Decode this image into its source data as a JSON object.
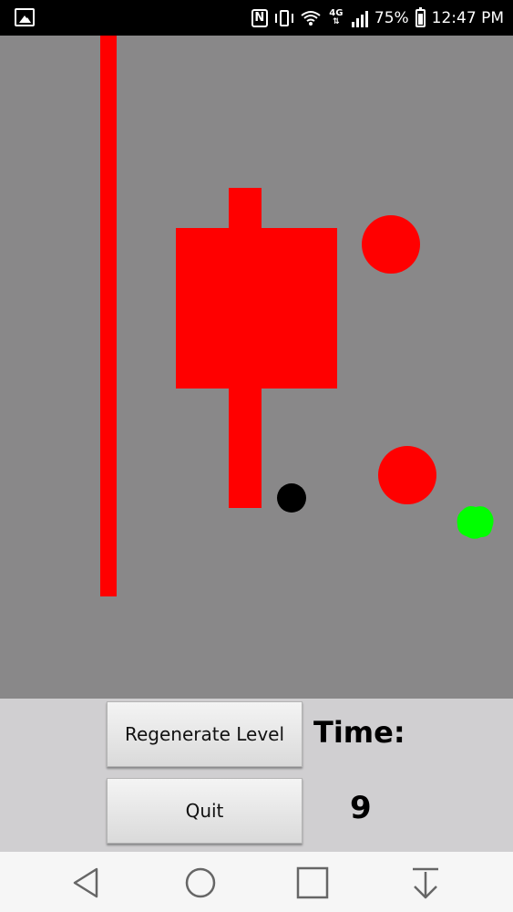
{
  "status_bar": {
    "left_icon": "image-icon",
    "icons": [
      "nfc-icon",
      "vibrate-icon",
      "wifi-icon",
      "4g-data-icon",
      "signal-icon",
      "battery-icon"
    ],
    "network_label": "4G",
    "nfc_label": "N",
    "battery": "75%",
    "time": "12:47 PM"
  },
  "game": {
    "background_color": "#898889",
    "obstacle_color": "#ff0000",
    "player_color": "#000000",
    "goal_color": "#00ff00"
  },
  "controls": {
    "regenerate_label": "Regenerate Level",
    "quit_label": "Quit",
    "time_label": "Time:",
    "time_value": "9"
  },
  "nav_bar": {
    "icons": [
      "back-icon",
      "home-icon",
      "recents-icon",
      "notifications-down-icon"
    ]
  }
}
